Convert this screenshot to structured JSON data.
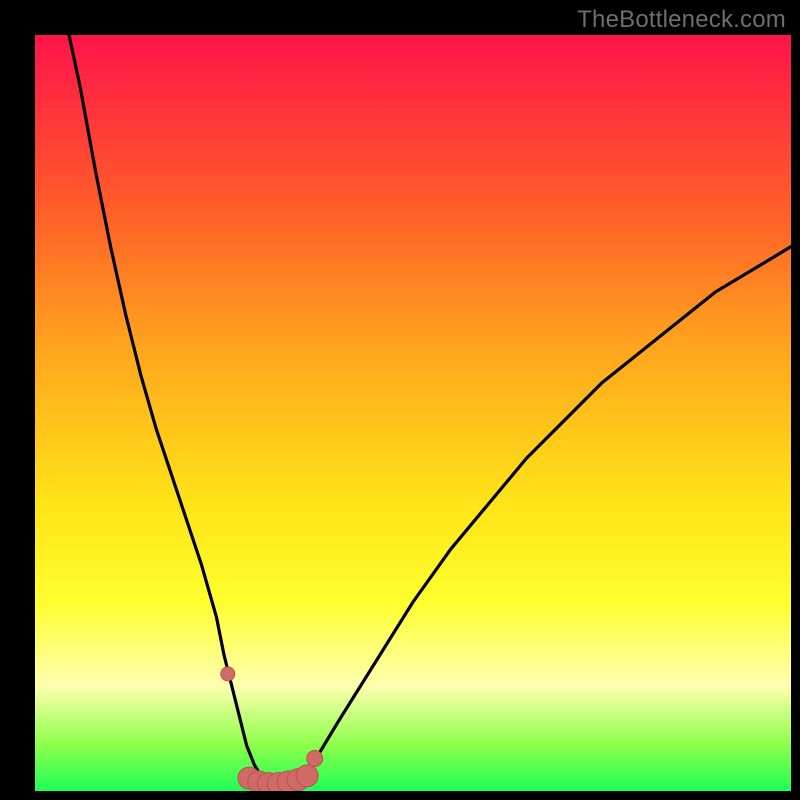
{
  "watermark": "TheBottleneck.com",
  "colors": {
    "gradient_top": "#ff144a",
    "gradient_mid1": "#ff5a2a",
    "gradient_mid2": "#ffa71d",
    "gradient_mid3": "#ffe418",
    "gradient_yellow": "#ffff2e",
    "gradient_pale": "#ffffb0",
    "gradient_lime": "#8cff4a",
    "gradient_green": "#1dff58",
    "curve": "#000000",
    "marker_fill": "#cf6a66",
    "marker_stroke": "#b85550"
  },
  "chart_data": {
    "type": "line",
    "title": "",
    "xlabel": "",
    "ylabel": "",
    "xlim": [
      0,
      100
    ],
    "ylim": [
      0,
      100
    ],
    "series": [
      {
        "name": "bottleneck-curve",
        "x": [
          4.5,
          6,
          8,
          10,
          12,
          14,
          16,
          18,
          20,
          22,
          24,
          25,
          26,
          27,
          28,
          29,
          30,
          31,
          32,
          33,
          34,
          35,
          37,
          40,
          45,
          50,
          55,
          60,
          65,
          70,
          75,
          80,
          85,
          90,
          95,
          100
        ],
        "y": [
          100,
          93,
          82,
          72,
          63,
          55,
          48,
          42,
          36,
          30,
          23,
          18,
          14,
          10,
          6,
          3.5,
          1.8,
          0.8,
          0.5,
          0.5,
          0.8,
          1.5,
          4,
          9,
          17,
          25,
          32,
          38,
          44,
          49,
          54,
          58,
          62,
          66,
          69,
          72
        ]
      }
    ],
    "markers": {
      "name": "highlight-band",
      "x": [
        25.5,
        28.3,
        29.6,
        30.9,
        32.2,
        33.5,
        34.8,
        36.0,
        37.0
      ],
      "y": [
        15.5,
        1.7,
        1.2,
        1.0,
        1.0,
        1.2,
        1.5,
        2.0,
        4.3
      ],
      "r": [
        7,
        11,
        11,
        11,
        11,
        11,
        11,
        11,
        8
      ]
    }
  }
}
